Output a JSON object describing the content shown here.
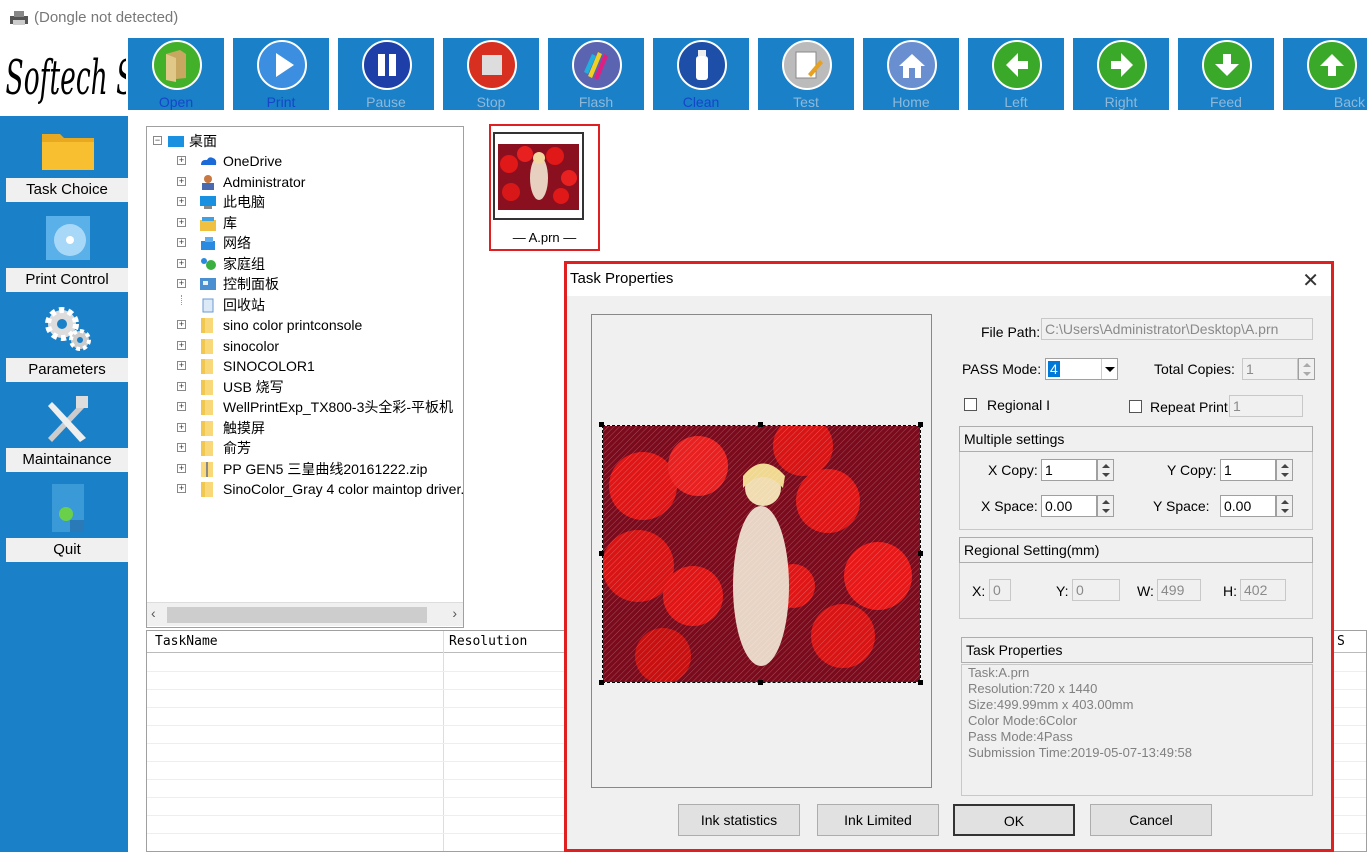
{
  "window": {
    "title": "(Dongle not detected)"
  },
  "brand": {
    "logo_text": "Softech Software",
    "accent": "#1a80c8"
  },
  "toolbar": {
    "buttons": [
      {
        "label": "Open",
        "icon": "open-folder-icon"
      },
      {
        "label": "Print",
        "icon": "play-icon"
      },
      {
        "label": "Pause",
        "icon": "pause-icon"
      },
      {
        "label": "Stop",
        "icon": "stop-icon"
      },
      {
        "label": "Flash",
        "icon": "color-flash-icon"
      },
      {
        "label": "Clean",
        "icon": "clean-bottle-icon"
      },
      {
        "label": "Test",
        "icon": "test-pen-icon"
      },
      {
        "label": "Home",
        "icon": "home-icon"
      },
      {
        "label": "Left",
        "icon": "arrow-left-icon"
      },
      {
        "label": "Right",
        "icon": "arrow-right-icon"
      },
      {
        "label": "Feed",
        "icon": "arrow-down-icon"
      },
      {
        "label": "Back",
        "icon": "arrow-up-icon"
      }
    ]
  },
  "sidebar": {
    "items": [
      {
        "label": "Task Choice",
        "icon": "folder-icon"
      },
      {
        "label": "Print Control",
        "icon": "cd-icon"
      },
      {
        "label": "Parameters",
        "icon": "gears-icon"
      },
      {
        "label": "Maintainance",
        "icon": "tools-icon"
      },
      {
        "label": "Quit",
        "icon": "quit-icon"
      }
    ]
  },
  "tree": {
    "root": "桌面",
    "items": [
      "OneDrive",
      "Administrator",
      "此电脑",
      "库",
      "网络",
      "家庭组",
      "控制面板",
      "回收站",
      "sino color printconsole",
      "sinocolor",
      "SINOCOLOR1",
      "USB 烧写",
      "WellPrintExp_TX800-3头全彩-平板机",
      "触摸屏",
      "俞芳",
      "PP GEN5 三皇曲线20161222.zip",
      "SinoColor_Gray 4 color maintop driver."
    ]
  },
  "file": {
    "name": "A.prn"
  },
  "table": {
    "columns": [
      "TaskName",
      "Resolution",
      "S"
    ]
  },
  "dialog": {
    "title": "Task Properties",
    "close": "✕",
    "file_path_label": "File Path:",
    "file_path": "C:\\Users\\Administrator\\Desktop\\A.prn",
    "pass_mode_label": "PASS Mode:",
    "pass_mode_value": "4",
    "total_copies_label": "Total Copies:",
    "total_copies_value": "1",
    "regional_label": "Regional I",
    "repeat_print_label": "Repeat Print",
    "repeat_print_value": "1",
    "multiple_settings_header": "Multiple settings",
    "x_copy_label": "X Copy:",
    "x_copy_value": "1",
    "y_copy_label": "Y Copy:",
    "y_copy_value": "1",
    "x_space_label": "X Space:",
    "x_space_value": "0.00",
    "y_space_label": "Y Space:",
    "y_space_value": "0.00",
    "regional_setting_header": "Regional Setting(mm)",
    "x_label": "X:",
    "x_value": "0",
    "y_label": "Y:",
    "y_value": "0",
    "w_label": "W:",
    "w_value": "499",
    "h_label": "H:",
    "h_value": "402",
    "task_properties_header": "Task Properties",
    "info": [
      "Task:A.prn",
      "Resolution:720 x 1440",
      "Size:499.99mm x 403.00mm",
      "Color Mode:6Color",
      "Pass Mode:4Pass",
      "Submission Time:2019-05-07-13:49:58"
    ],
    "buttons": {
      "ink_statistics": "Ink statistics",
      "ink_limited": "Ink Limited",
      "ok": "OK",
      "cancel": "Cancel"
    }
  }
}
